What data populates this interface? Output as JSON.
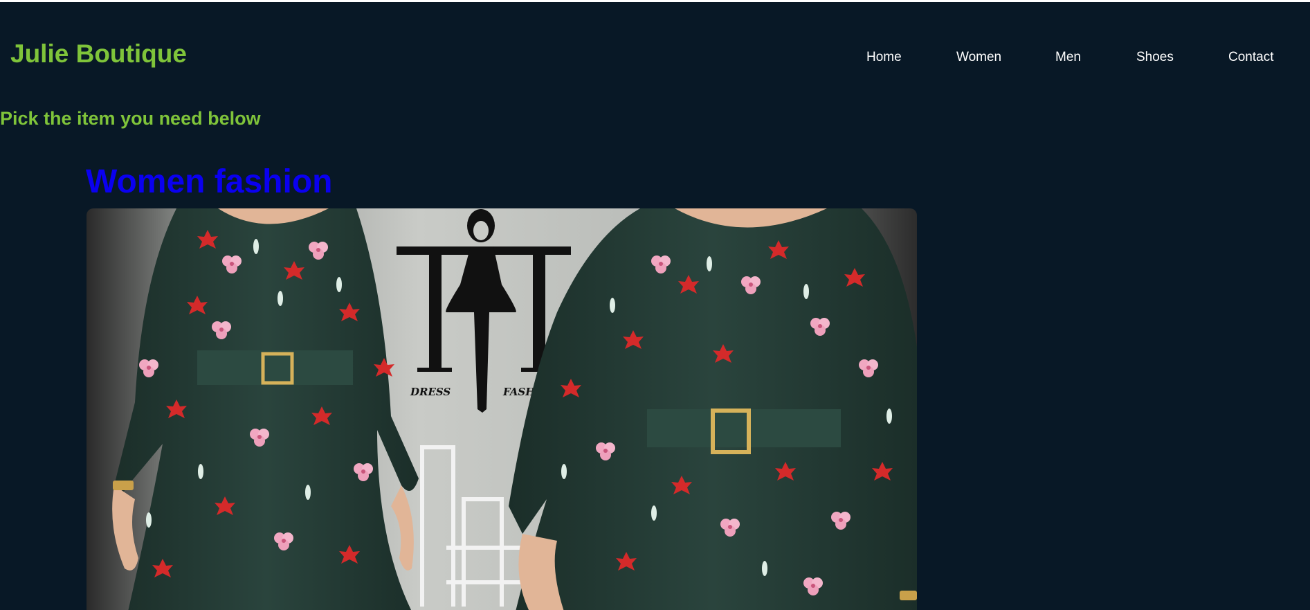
{
  "header": {
    "brand": "Julie Boutique",
    "nav": [
      {
        "label": "Home"
      },
      {
        "label": "Women"
      },
      {
        "label": "Men"
      },
      {
        "label": "Shoes"
      },
      {
        "label": "Contact"
      }
    ]
  },
  "main": {
    "subtitle": "Pick the item you need below",
    "section_title": "Women fashion",
    "hero_image": {
      "logo_text": "TT",
      "logo_left_word": "DRESS",
      "logo_right_word": "FASHION"
    }
  },
  "colors": {
    "background": "#081826",
    "brand_green": "#7fc43a",
    "section_blue": "#0a00f0",
    "nav_text": "#ffffff",
    "dress_green": "#223a34",
    "flower_red": "#d42a2a",
    "flower_pink": "#f1a7c1"
  }
}
